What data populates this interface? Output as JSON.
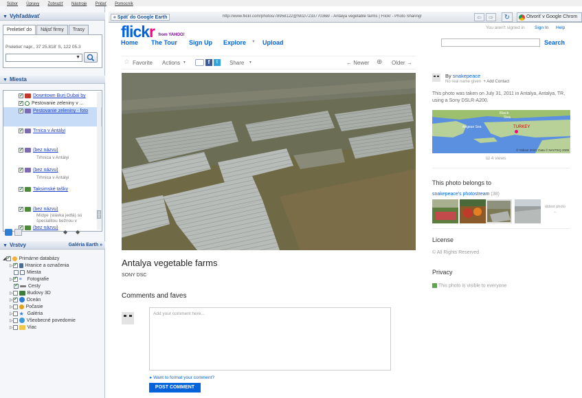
{
  "menubar": {
    "items": [
      "Súbor",
      "Úpravy",
      "Zobraziť",
      "Nástroje",
      "Pridať",
      "Pomocník"
    ]
  },
  "sidebar": {
    "search_header": "Vyhľadávať",
    "tabs": [
      "Preletieť do",
      "Nájsť firmy",
      "Trasy"
    ],
    "fly_hint": "Preletieť napr., 37 25.818' S, 122 05.3",
    "places_header": "Miesta",
    "places": [
      {
        "label": "Downtown Burj Dubai by",
        "link": true
      },
      {
        "label": "Pestovanie zeleniny v ...",
        "link": false
      },
      {
        "label": "Pestovanie zeleniny - foto",
        "link": true
      },
      {
        "label": "Trnica v Antályi",
        "link": true
      },
      {
        "label": "(bez názvu)",
        "sub": "Trhnica v Antályi",
        "link": true
      },
      {
        "label": "(bez názvu)",
        "sub": "Trhnica v Antályi",
        "link": true
      },
      {
        "label": "Taksimské tašky",
        "link": true
      },
      {
        "label": "(bez názvu)",
        "sub": "Mídye (slávka jedlá) sú špecialitou bežnou v",
        "link": true
      },
      {
        "label": "(bez názvu)",
        "link": true
      }
    ],
    "layers_header": "Vrstvy",
    "gallery_link": "Galéria Earth »",
    "layers": [
      "Primárne databázy",
      "Hranice a označenia",
      "Miesta",
      "Fotografie",
      "Cesty",
      "Budovy 3D",
      "Oceán",
      "Počasie",
      "Galéria",
      "Všeobecné povedomie",
      "Viac"
    ]
  },
  "browser": {
    "back_label": "« Späť do Google Earth",
    "url": "http://www.flickr.com/photos/78958122@N02/7233770368/ - Antalya vegetable farms | Flickr - Photo Sharing!",
    "open_label": "Otvoriť v Google Chrom"
  },
  "flickr": {
    "logo": "flickr",
    "yahoo": "from YAHOO!",
    "nav": [
      "Home",
      "The Tour",
      "Sign Up",
      "Explore",
      "Upload"
    ],
    "signin_text": "You aren't signed in",
    "sign_in": "Sign In",
    "help": "Help",
    "search_label": "Search",
    "actions": {
      "favorite": "Favorite",
      "actions": "Actions",
      "share": "Share",
      "newer": "← Newer",
      "older": "Older →"
    },
    "title": "Antalya vegetable farms",
    "camera": "SONY DSC",
    "comments_header": "Comments and faves",
    "comment_placeholder": "Add your comment here...",
    "format_hint": "Want to format your comment?",
    "post_button": "POST COMMENT",
    "author": {
      "by": "By",
      "name": "snakepeace",
      "no_name": "No real name given",
      "add_contact": "+ Add Contact"
    },
    "taken": "This photo was taken on July 31, 2011 in Antalya, Antalya, TR, using a Sony DSLR-A200.",
    "map": {
      "black": "Black",
      "sea": "Sea",
      "turkey": "TURKEY",
      "aegean": "Aegean Sea",
      "credit": "© Yahoo! 2010, Data © NAVTEQ 2009"
    },
    "views": "4 views",
    "belongs_header": "This photo belongs to",
    "photostream": "snakepeace's photostream",
    "photostream_count": "(38)",
    "oldest": "oldest photo",
    "license_header": "License",
    "license_text": "All Rights Reserved",
    "privacy_header": "Privacy",
    "privacy_text": "This photo is visible to everyone"
  }
}
